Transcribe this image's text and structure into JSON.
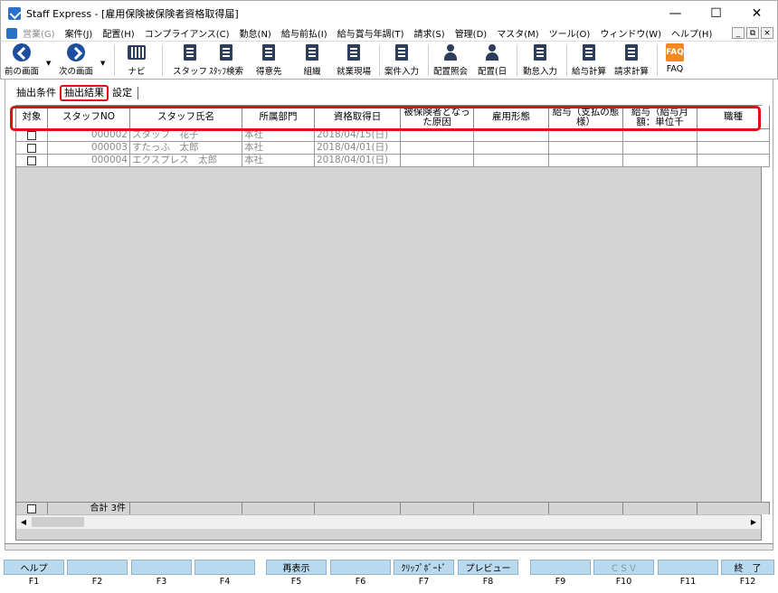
{
  "window": {
    "title": "Staff Express - [雇用保険被保険者資格取得届]"
  },
  "menu": [
    {
      "label": "営業(G)",
      "dim": true
    },
    {
      "label": "案件(J)",
      "dim": false
    },
    {
      "label": "配置(H)",
      "dim": false
    },
    {
      "label": "コンプライアンス(C)",
      "dim": false
    },
    {
      "label": "勤怠(N)",
      "dim": false
    },
    {
      "label": "給与前払(I)",
      "dim": false
    },
    {
      "label": "給与賞与年調(T)",
      "dim": false
    },
    {
      "label": "請求(S)",
      "dim": false
    },
    {
      "label": "管理(D)",
      "dim": false
    },
    {
      "label": "マスタ(M)",
      "dim": false
    },
    {
      "label": "ツール(O)",
      "dim": false
    },
    {
      "label": "ウィンドウ(W)",
      "dim": false
    },
    {
      "label": "ヘルプ(H)",
      "dim": false
    }
  ],
  "toolbar": {
    "prev": "前の画面",
    "next": "次の画面",
    "navi": "ナビ",
    "staff": "スタッフ",
    "staff_search": "ｽﾀｯﾌ検索",
    "client": "得意先",
    "org": "組織",
    "workplace": "就業現場",
    "case_input": "案件入力",
    "assign_inquiry": "配置照会",
    "assign_day": "配置(日",
    "attendance": "勤怠入力",
    "payroll": "給与計算",
    "billing": "請求計算",
    "faq": "FAQ"
  },
  "tabs": [
    "抽出条件",
    "抽出結果",
    "設定"
  ],
  "grid": {
    "headers": [
      "対象",
      "スタッフNO",
      "スタッフ氏名",
      "所属部門",
      "資格取得日",
      "被保険者となった原因",
      "雇用形態",
      "給与（支払の態様）",
      "給与（給与月額：単位千",
      "職種"
    ],
    "rows": [
      {
        "no": "000002",
        "name": "スタッフ　花子",
        "dept": "本社",
        "date": "2018/04/15(日)"
      },
      {
        "no": "000003",
        "name": "すたっふ　太郎",
        "dept": "本社",
        "date": "2018/04/01(日)"
      },
      {
        "no": "000004",
        "name": "エクスプレス　太郎",
        "dept": "本社",
        "date": "2018/04/01(日)"
      }
    ],
    "total": "合計 3件"
  },
  "fkeys": [
    {
      "label": "ヘルプ",
      "key": "F1",
      "dim": false
    },
    {
      "label": "",
      "key": "F2",
      "dim": false
    },
    {
      "label": "",
      "key": "F3",
      "dim": false
    },
    {
      "label": "",
      "key": "F4",
      "dim": false
    },
    {
      "label": "再表示",
      "key": "F5",
      "dim": false
    },
    {
      "label": "",
      "key": "F6",
      "dim": false
    },
    {
      "label": "ｸﾘｯﾌﾟﾎﾞｰﾄﾞ",
      "key": "F7",
      "dim": false
    },
    {
      "label": "プレビュー",
      "key": "F8",
      "dim": false
    },
    {
      "label": "",
      "key": "F9",
      "dim": false
    },
    {
      "label": "ＣＳＶ",
      "key": "F10",
      "dim": true
    },
    {
      "label": "",
      "key": "F11",
      "dim": false
    },
    {
      "label": "終　了",
      "key": "F12",
      "dim": false
    }
  ]
}
